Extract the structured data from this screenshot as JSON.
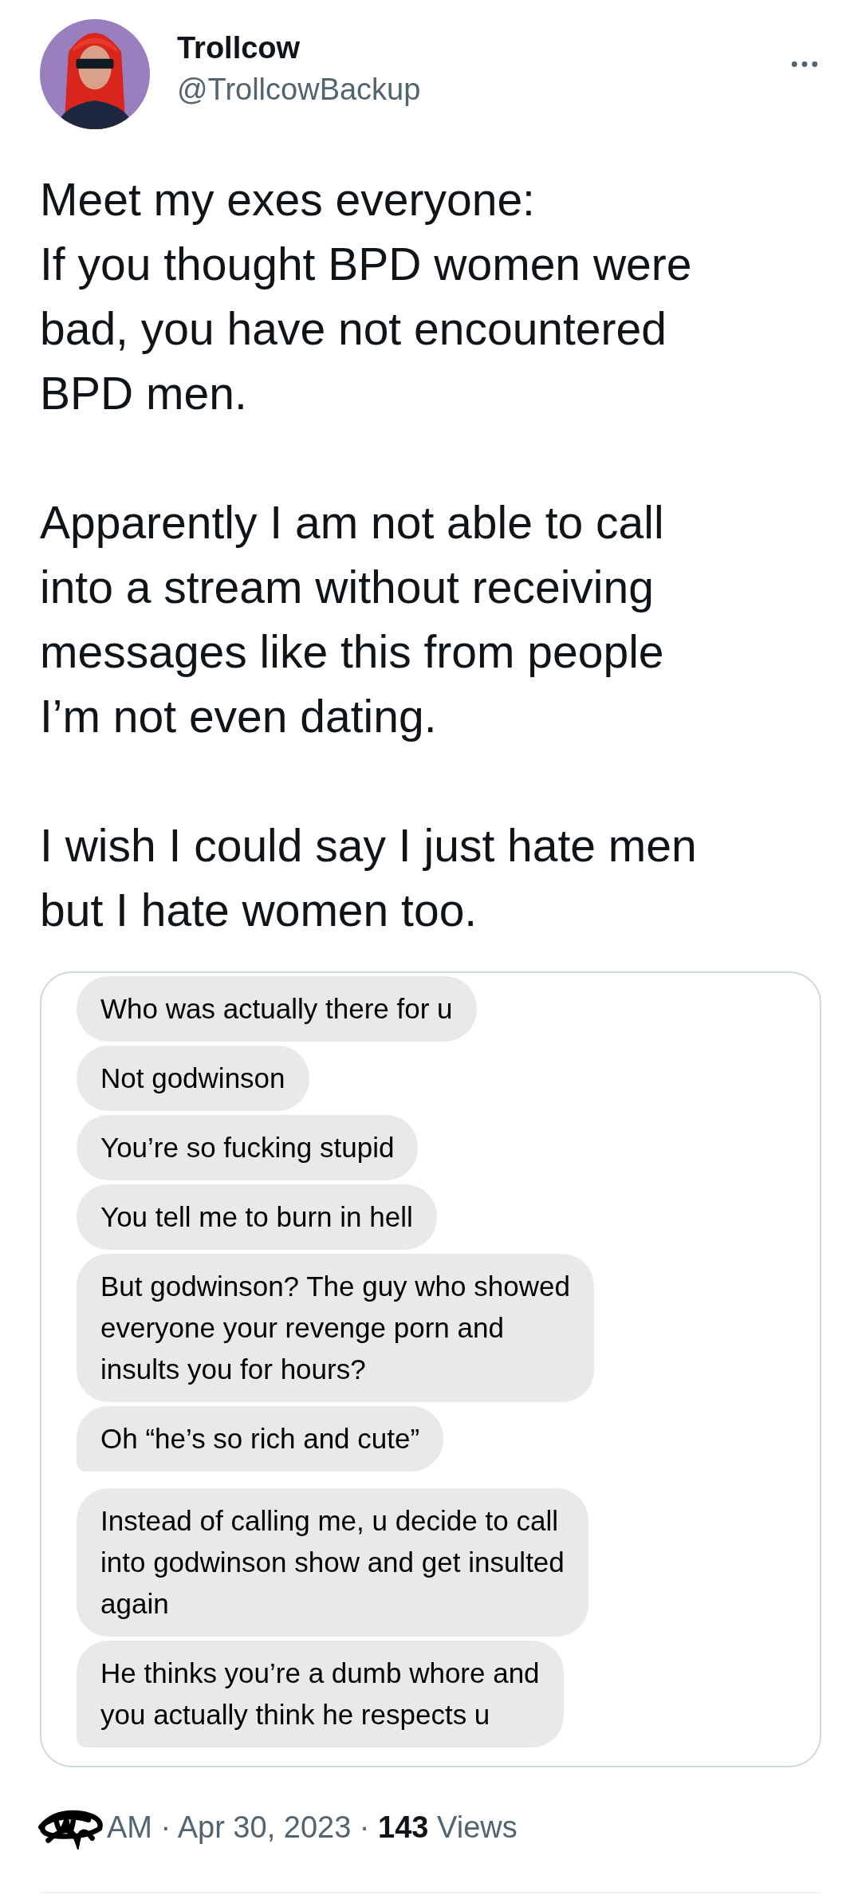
{
  "author": {
    "name": "Trollcow",
    "handle": "@TrollcowBackup"
  },
  "tweet": {
    "paragraphs": [
      [
        "Meet my exes everyone:",
        "If you thought BPD women were",
        "bad, you have not encountered",
        "BPD men."
      ],
      [
        "Apparently I am not able to call",
        "into a stream without receiving",
        "messages like this from people",
        "I’m not even dating."
      ],
      [
        "I wish I could say I just hate men",
        "but I hate women too."
      ]
    ]
  },
  "messages": [
    {
      "lines": [
        "Who was actually there for u"
      ],
      "tail": false
    },
    {
      "lines": [
        "Not godwinson"
      ],
      "tail": false
    },
    {
      "lines": [
        "You’re so fucking stupid"
      ],
      "tail": false
    },
    {
      "lines": [
        "You tell me to burn in hell"
      ],
      "tail": false
    },
    {
      "lines": [
        "But godwinson? The guy who showed",
        "everyone your revenge porn and",
        "insults you for hours?"
      ],
      "tail": false
    },
    {
      "lines": [
        "Oh “he’s so rich and cute”"
      ],
      "tail": true
    },
    {
      "lines": [
        "Instead of calling me, u decide to call",
        "into godwinson show and get insulted",
        "again"
      ],
      "tail": false
    },
    {
      "lines": [
        "He thinks you’re a dumb whore and",
        "you actually think he respects u"
      ],
      "tail": true
    }
  ],
  "meta": "AM · Apr 30, 2023 · **143** Views"
}
